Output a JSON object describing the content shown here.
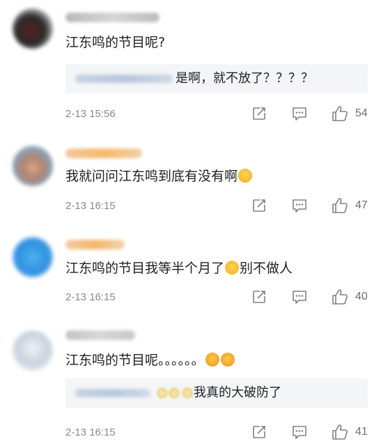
{
  "comments": [
    {
      "content": "江东鸣的节目呢?",
      "reply": {
        "text": "是啊，就不放了？？？？"
      },
      "time": "2-13 15:56",
      "likes": "54"
    },
    {
      "content": "我就问问江东鸣到底有没有啊",
      "content_emoji": "pleading-face-emoji",
      "time": "2-13 16:15",
      "likes": "47"
    },
    {
      "content_before": "江东鸣的节目我等半个月了",
      "content_emoji": "sweat-smile-emoji",
      "content_after": "别不做人",
      "time": "2-13 16:15",
      "likes": "40"
    },
    {
      "content": "江东鸣的节目呢。。。。。。",
      "content_emoji": "crying-face-emoji",
      "reply": {
        "text": "我真的大破防了"
      },
      "time": "2-13 16:15",
      "likes": "41"
    }
  ],
  "icons": {
    "share": "share-icon",
    "comment": "comment-icon",
    "like": "thumbs-up-icon"
  },
  "colors": {
    "meta_text": "#8a8a8a",
    "icon": "#808080",
    "reply_bg": "#f4f5f7"
  }
}
